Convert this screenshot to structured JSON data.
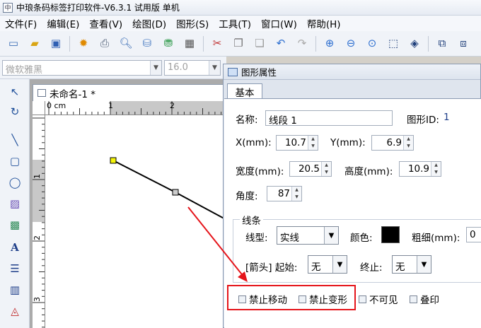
{
  "window": {
    "title": "中琅条码标签打印软件-V6.3.1 试用版 单机",
    "logo": "中"
  },
  "menu": [
    "文件(F)",
    "编辑(E)",
    "查看(V)",
    "绘图(D)",
    "图形(S)",
    "工具(T)",
    "窗口(W)",
    "帮助(H)"
  ],
  "fontbar": {
    "font": "微软雅黑",
    "size": "16.0"
  },
  "document": {
    "tab_title": "未命名-1 *",
    "ruler_h": [
      "0 cm",
      "1",
      "2"
    ],
    "ruler_v": [
      "1",
      "2",
      "3"
    ]
  },
  "dialog": {
    "title": "图形属性",
    "tab": "基本",
    "name_label": "名称:",
    "name_value": "线段 1",
    "shape_id_label": "图形ID:",
    "shape_id_value": "1",
    "x_label": "X(mm):",
    "x_value": "10.7",
    "y_label": "Y(mm):",
    "y_value": "6.9",
    "width_label": "宽度(mm):",
    "width_value": "20.5",
    "height_label": "高度(mm):",
    "height_value": "10.9",
    "angle_label": "角度:",
    "angle_value": "87",
    "line_group": "线条",
    "linetype_label": "线型:",
    "linetype_value": "实线",
    "color_label": "颜色:",
    "color_value": "#000000",
    "thickness_label": "粗细(mm):",
    "thickness_value": "0",
    "arrow_label": "[箭头] 起始:",
    "arrow_start": "无",
    "arrow_end_label": "终止:",
    "arrow_end": "无",
    "checkbox_no_move": "禁止移动",
    "checkbox_no_transform": "禁止变形",
    "checkbox_invisible": "不可见",
    "checkbox_overprint": "叠印"
  },
  "colors": {
    "highlight_border": "#e5151b",
    "annotation_arrow": "#e5151b",
    "handle_start": "#f5f50a"
  }
}
